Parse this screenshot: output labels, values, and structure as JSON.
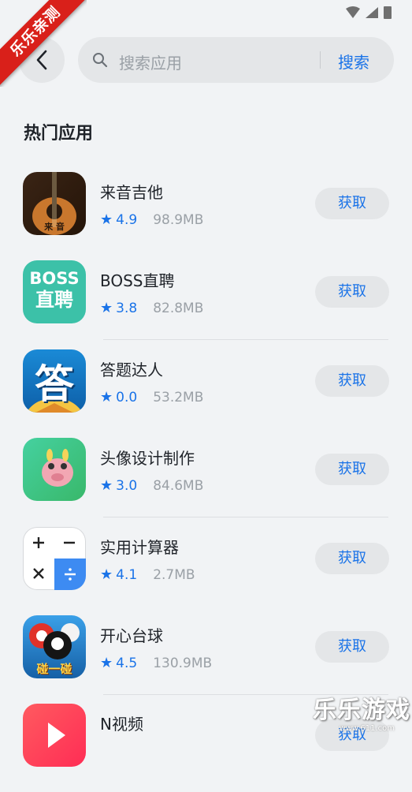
{
  "ribbon": {
    "text": "乐乐亲测"
  },
  "header": {
    "search_placeholder": "搜索应用",
    "search_button": "搜索"
  },
  "section": {
    "title": "热门应用"
  },
  "apps": [
    {
      "name": "来音吉他",
      "rating": "4.9",
      "size": "98.9MB",
      "action": "获取",
      "icon_label": "来 音"
    },
    {
      "name": "BOSS直聘",
      "rating": "3.8",
      "size": "82.8MB",
      "action": "获取",
      "icon_line1": "BOSS",
      "icon_line2": "直聘"
    },
    {
      "name": "答题达人",
      "rating": "0.0",
      "size": "53.2MB",
      "action": "获取",
      "icon_label": "答"
    },
    {
      "name": "头像设计制作",
      "rating": "3.0",
      "size": "84.6MB",
      "action": "获取"
    },
    {
      "name": "实用计算器",
      "rating": "4.1",
      "size": "2.7MB",
      "action": "获取"
    },
    {
      "name": "开心台球",
      "rating": "4.5",
      "size": "130.9MB",
      "action": "获取",
      "icon_label": "碰一碰"
    },
    {
      "name": "N视频",
      "rating": "",
      "size": "",
      "action": "获取"
    }
  ],
  "watermark": {
    "title": "乐乐游戏",
    "url": "www.611.com"
  },
  "colors": {
    "accent": "#1a73e8",
    "background": "#f1f3f5",
    "button_bg": "#e4e6e8",
    "ribbon": "#d9201a"
  }
}
